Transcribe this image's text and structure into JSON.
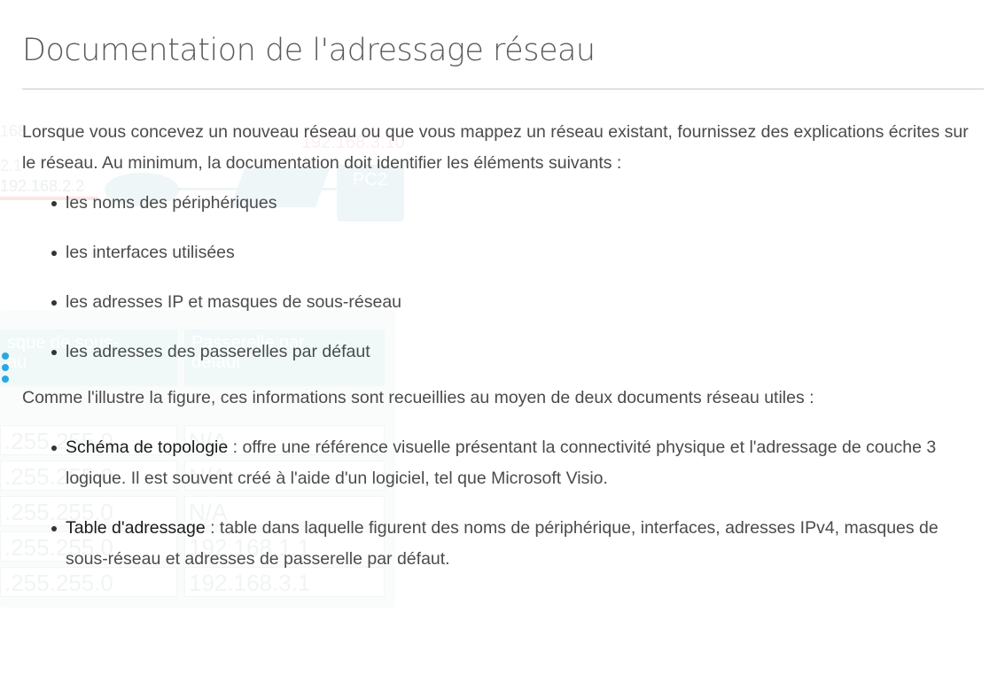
{
  "title": "Documentation de l'adressage réseau",
  "intro": "Lorsque vous concevez un nouveau réseau ou que vous mappez un réseau existant, fournissez des explications écrites sur le réseau. Au minimum, la documentation doit identifier les éléments suivants :",
  "elements": [
    "les noms des périphériques",
    "les interfaces utilisées",
    "les adresses IP et masques de sous-réseau",
    "les adresses des passerelles par défaut"
  ],
  "figure_intro": "Comme l'illustre la figure, ces informations sont recueillies au moyen de deux documents réseau utiles :",
  "documents": [
    {
      "term": "Schéma de topologie",
      "description": " : offre une référence visuelle présentant la connectivité physique et l'adressage de couche 3 logique. Il est souvent créé à l'aide d'un logiciel, tel que Microsoft Visio."
    },
    {
      "term": "Table d'adressage",
      "description": " : table dans laquelle figurent des noms de périphérique, interfaces, adresses IPv4, masques de sous-réseau et adresses de passerelle par défaut."
    }
  ],
  "background_figure": {
    "topology_labels": [
      "168.",
      "192.168.3.10",
      "2.1",
      "192.168.2.2",
      "PC2"
    ],
    "table_headers": [
      "sque de sous-\nau",
      "Passerelle par\ndéfaut"
    ],
    "table_rows": [
      [
        ".255.255.0",
        "N/A"
      ],
      [
        ".255.255.0",
        "N/A"
      ],
      [
        ".255.255.0",
        "N/A"
      ],
      [
        ".255.255.0",
        "192.168.1.1"
      ],
      [
        ".255.255.0",
        "192.168.3.1"
      ]
    ],
    "accent_color": "#2aa8e0"
  }
}
